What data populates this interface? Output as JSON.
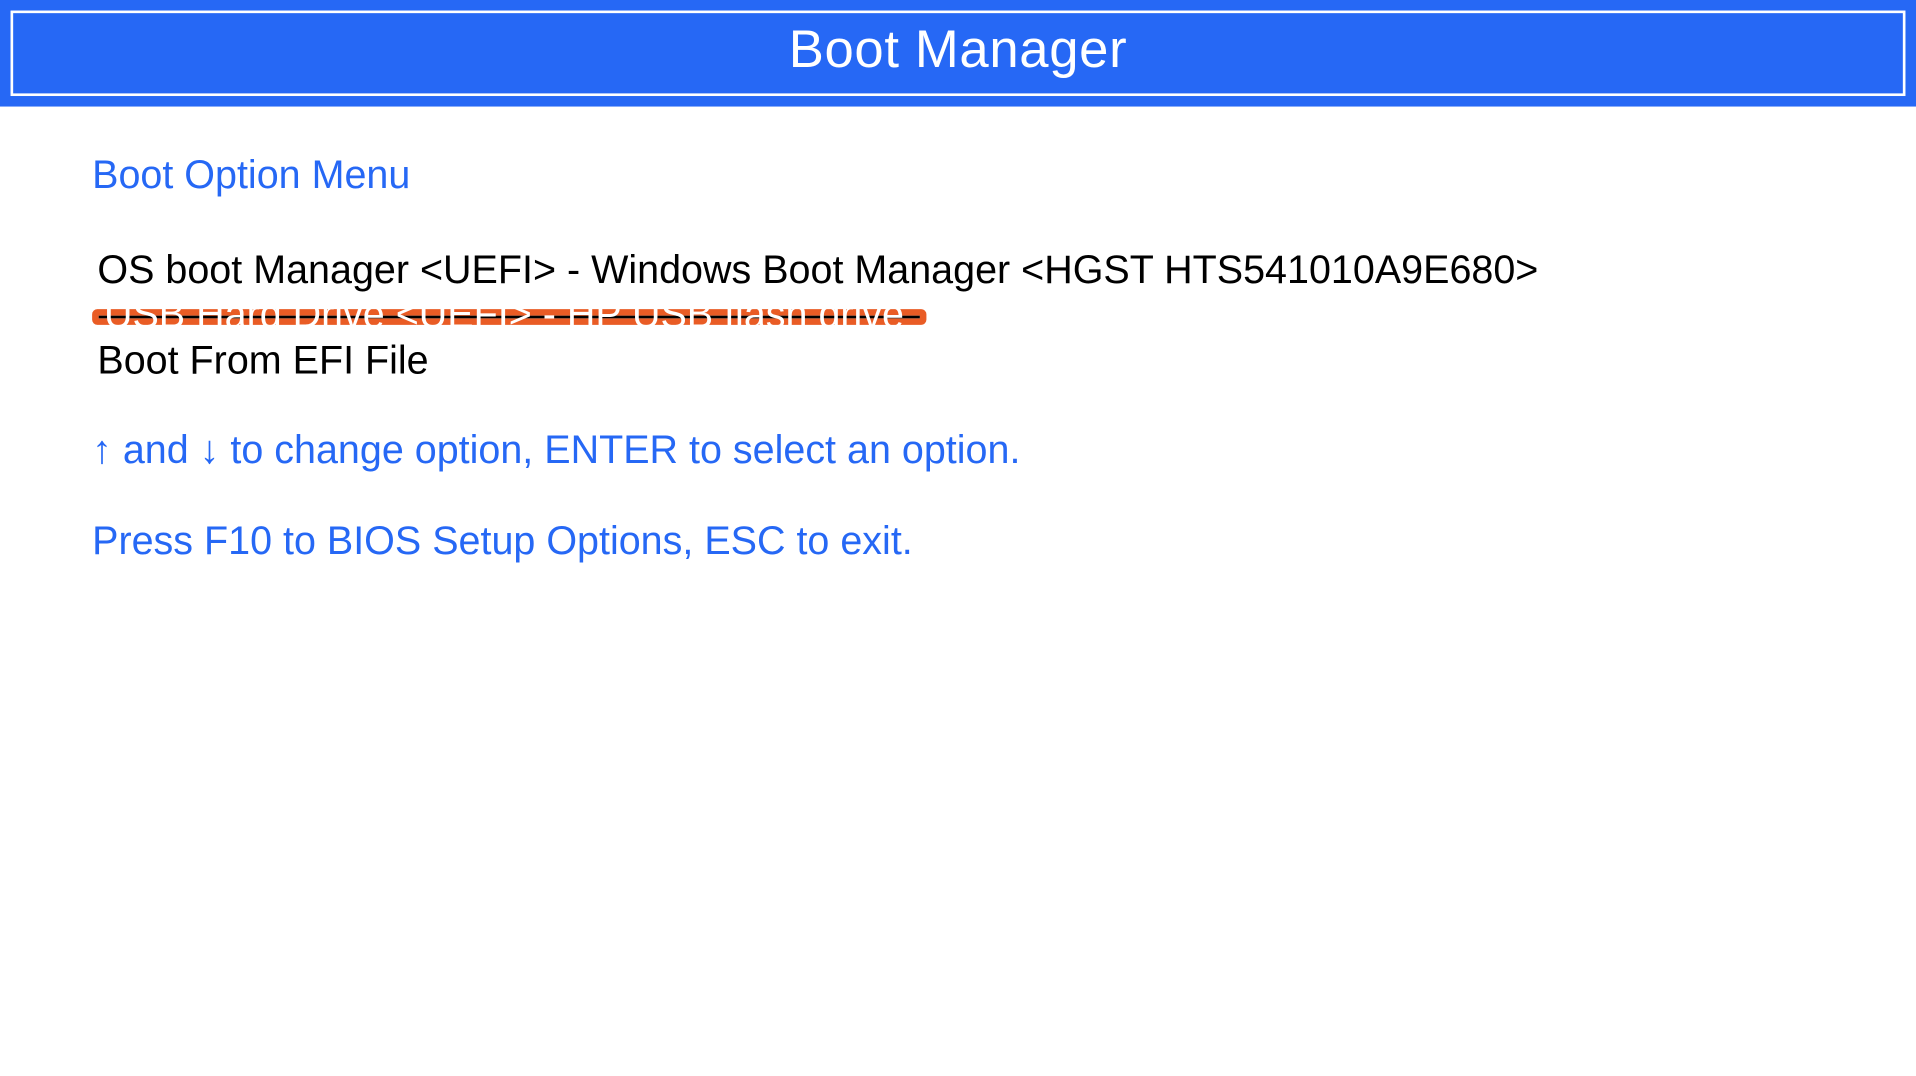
{
  "header": {
    "title": "Boot Manager"
  },
  "menu": {
    "section_title": "Boot Option Menu",
    "items": [
      {
        "label": "OS boot Manager <UEFI> - Windows Boot Manager <HGST HTS541010A9E680>",
        "selected": false,
        "highlighted": false
      },
      {
        "label": "USB Hard Drive <UEFI> - HP USB flash drive",
        "selected": true,
        "highlighted": true
      },
      {
        "label": "Boot From EFI File",
        "selected": false,
        "highlighted": false
      }
    ]
  },
  "help": {
    "navigation": "↑ and ↓ to change option, ENTER to select an option.",
    "extra": "Press F10 to BIOS Setup Options, ESC to exit."
  }
}
